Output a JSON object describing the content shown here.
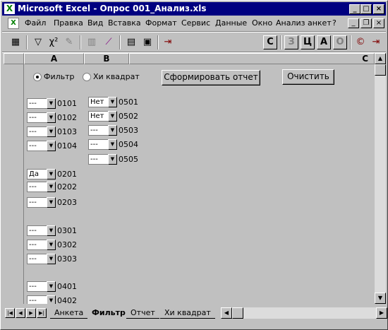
{
  "window": {
    "title": "Microsoft Excel - Опрос 001_Анализ.xls",
    "app_icon": "excel-icon"
  },
  "menu": [
    "Файл",
    "Правка",
    "Вид",
    "Вставка",
    "Формат",
    "Сервис",
    "Данные",
    "Окно",
    "Анализ анкет",
    "?"
  ],
  "toolbar": {
    "text_buttons": [
      "C",
      "З",
      "Ц",
      "А",
      "О"
    ]
  },
  "columns": [
    "A",
    "B",
    "C"
  ],
  "controls": {
    "radio_filter": "Фильтр",
    "radio_chi": "Хи квадрат",
    "radio_selected": "Фильтр",
    "report_button": "Сформировать отчет",
    "clear_button": "Очистить"
  },
  "dropdowns_col1": [
    {
      "value": "---",
      "label": "0101"
    },
    {
      "value": "---",
      "label": "0102"
    },
    {
      "value": "---",
      "label": "0103"
    },
    {
      "value": "---",
      "label": "0104"
    },
    {
      "value": "Да",
      "label": "0201"
    },
    {
      "value": "---",
      "label": "0202"
    },
    {
      "value": "---",
      "label": "0203"
    },
    {
      "value": "---",
      "label": "0301"
    },
    {
      "value": "---",
      "label": "0302"
    },
    {
      "value": "---",
      "label": "0303"
    },
    {
      "value": "---",
      "label": "0401"
    },
    {
      "value": "---",
      "label": "0402"
    }
  ],
  "dropdowns_col2": [
    {
      "value": "Нет",
      "label": "0501"
    },
    {
      "value": "Нет",
      "label": "0502"
    },
    {
      "value": "---",
      "label": "0503"
    },
    {
      "value": "---",
      "label": "0504"
    },
    {
      "value": "---",
      "label": "0505"
    }
  ],
  "sheet_tabs": [
    "Анкета",
    "Фильтр",
    "Отчет",
    "Хи квадрат"
  ],
  "active_tab": "Фильтр"
}
